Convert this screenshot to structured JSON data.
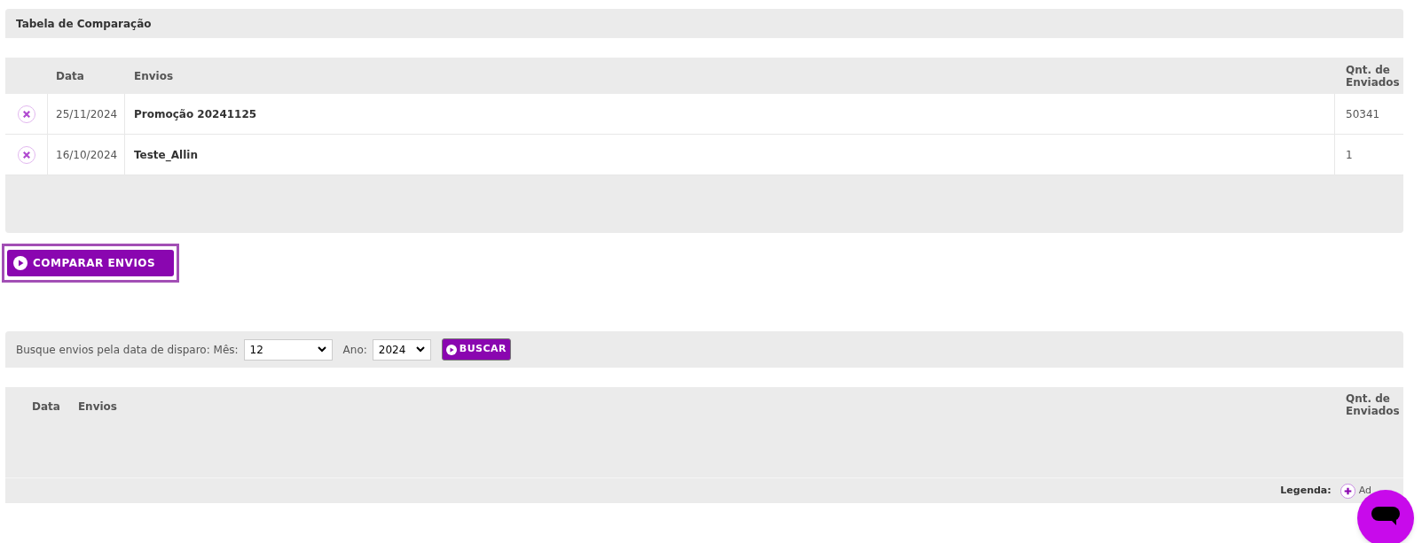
{
  "comparison_panel": {
    "title": "Tabela de Comparação"
  },
  "comparison_table": {
    "columns": [
      "Data",
      "Envios",
      "Qnt. de Enviados"
    ],
    "rows": [
      {
        "date": "25/11/2024",
        "name": "Promoção 20241125",
        "count": "50341"
      },
      {
        "date": "16/10/2024",
        "name": "Teste_Allin",
        "count": "1"
      }
    ]
  },
  "compare_button": {
    "label": "COMPARAR ENVIOS"
  },
  "search_bar": {
    "label": "Busque envios pela data de disparo: Mês:",
    "month": "12",
    "year_label": "Ano:",
    "year": "2024",
    "button": "BUSCAR"
  },
  "results_table": {
    "columns": [
      "Data",
      "Envios",
      "Qnt. de Enviados"
    ]
  },
  "legend": {
    "label": "Legenda:",
    "items": [
      "Ad"
    ]
  }
}
